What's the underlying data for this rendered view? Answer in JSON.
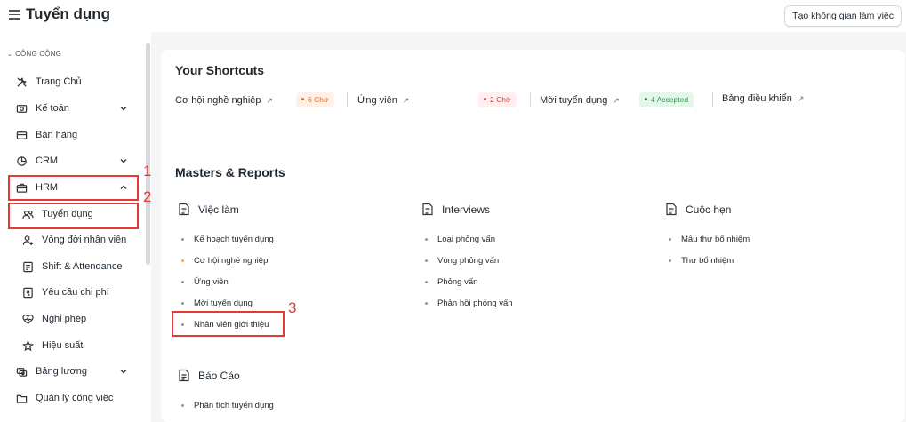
{
  "header": {
    "title": "Tuyển dụng",
    "create_workspace_label": "Tạo không gian làm việc"
  },
  "sidebar": {
    "section_label": "CÔNG CỘNG",
    "items": [
      {
        "label": "Trang Chủ",
        "icon": "tools-icon",
        "caret": "none"
      },
      {
        "label": "Kế toán",
        "icon": "accounting-icon",
        "caret": "down"
      },
      {
        "label": "Bán hàng",
        "icon": "card-icon",
        "caret": "none"
      },
      {
        "label": "CRM",
        "icon": "pie-chart-icon",
        "caret": "down"
      },
      {
        "label": "HRM",
        "icon": "briefcase-icon",
        "caret": "up"
      },
      {
        "label": "Tuyển dụng",
        "icon": "users-icon",
        "caret": "none"
      },
      {
        "label": "Vòng đời nhân viên",
        "icon": "user-add-icon",
        "caret": "none"
      },
      {
        "label": "Shift & Attendance",
        "icon": "list-icon",
        "caret": "none"
      },
      {
        "label": "Yêu cầu chi phí",
        "icon": "rupee-receipt-icon",
        "caret": "none"
      },
      {
        "label": "Nghỉ phép",
        "icon": "heart-pulse-icon",
        "caret": "none"
      },
      {
        "label": "Hiệu suất",
        "icon": "star-icon",
        "caret": "none"
      },
      {
        "label": "Bảng lương",
        "icon": "payroll-icon",
        "caret": "down"
      },
      {
        "label": "Quản lý công việc",
        "icon": "folder-icon",
        "caret": "none"
      }
    ]
  },
  "annotations": {
    "n1": "1",
    "n2": "2",
    "n3": "3"
  },
  "shortcuts": {
    "title": "Your Shortcuts",
    "items": [
      {
        "label": "Cơ hội nghề nghiệp",
        "badge": "6 Chờ",
        "badge_color": "#e86c13"
      },
      {
        "label": "Ứng viên",
        "badge": "2 Chờ",
        "badge_color": "#e03636"
      },
      {
        "label": "Mời tuyển dụng",
        "badge": "4 Accepted",
        "badge_color": "#2f8f4a"
      },
      {
        "label": "Bảng điều khiển",
        "badge": "",
        "badge_color": ""
      }
    ]
  },
  "masters": {
    "title": "Masters & Reports",
    "groups": [
      {
        "title": "Việc làm",
        "links": [
          "Kế hoạch tuyển dụng",
          "Cơ hội nghề nghiệp",
          "Ứng viên",
          "Mời tuyển dụng",
          "Nhân viên giới thiệu"
        ]
      },
      {
        "title": "Interviews",
        "links": [
          "Loại phỏng vấn",
          "Vòng phỏng vấn",
          "Phỏng vấn",
          "Phản hồi phỏng vấn"
        ]
      },
      {
        "title": "Cuộc hẹn",
        "links": [
          "Mẫu thư bổ nhiệm",
          "Thư bổ nhiệm"
        ]
      },
      {
        "title": "Báo Cáo",
        "links": [
          "Phân tích tuyển dụng"
        ]
      }
    ]
  },
  "colors": {
    "highlight": "#e53935",
    "content_bg": "#f4f5f6"
  }
}
